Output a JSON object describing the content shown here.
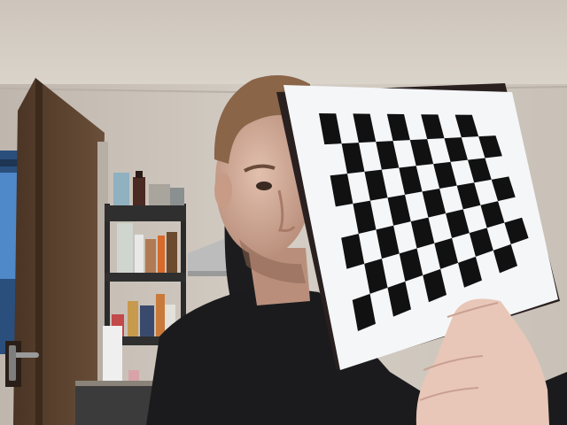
{
  "scene": {
    "subjects": [
      "person-holding-checkerboard",
      "calibration-checkerboard",
      "open-wooden-door",
      "metal-shelf-with-bottles",
      "kitchen-range-hood",
      "office-chair",
      "hand"
    ],
    "checkerboard": {
      "rows": 7,
      "cols": 10,
      "square_color": "#111111",
      "paper_color": "#f5f6f8"
    },
    "colors": {
      "ceiling": "#d4cdc4",
      "wall": "#cfc7bd",
      "door": "#5b4330",
      "shirt": "#1b1b1d",
      "skin": "#d8b3a0",
      "hair": "#8a6548"
    }
  }
}
